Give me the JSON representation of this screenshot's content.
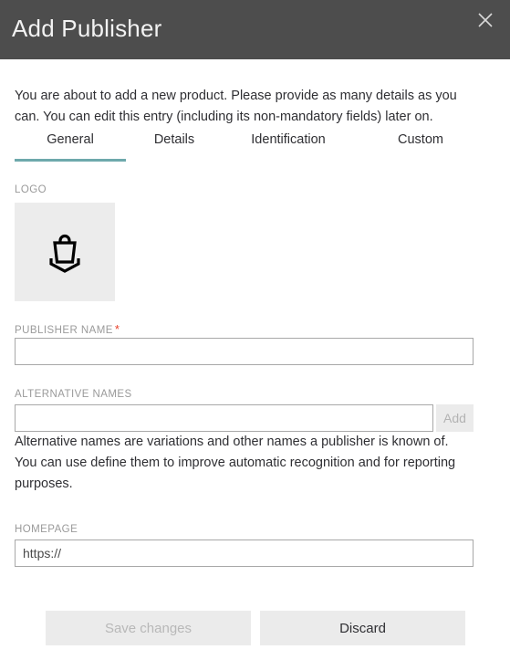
{
  "header": {
    "title": "Add Publisher",
    "close_icon": "close-icon"
  },
  "intro": {
    "text": "You are about to add a new product. Please provide as many details as you can. You can edit this entry (including its non-mandatory fields) later on."
  },
  "tabs": [
    {
      "label": "General",
      "active": true
    },
    {
      "label": "Details",
      "active": false
    },
    {
      "label": "Identification",
      "active": false
    },
    {
      "label": "Custom",
      "active": false
    }
  ],
  "fields": {
    "logo": {
      "label": "LOGO",
      "icon": "shopping-bag-upload-icon"
    },
    "publisher_name": {
      "label": "PUBLISHER NAME",
      "required_marker": "*",
      "value": "",
      "placeholder": ""
    },
    "alternative_names": {
      "label": "ALTERNATIVE NAMES",
      "value": "",
      "placeholder": "",
      "add_label": "Add",
      "help": "Alternative names are variations and other names a publisher is known of. You can use define them to improve automatic recognition and for reporting purposes."
    },
    "homepage": {
      "label": "HOMEPAGE",
      "value": "https://",
      "placeholder": "https://"
    }
  },
  "footer": {
    "save_label": "Save changes",
    "discard_label": "Discard"
  },
  "colors": {
    "header_bg": "#4d4d4d",
    "accent_underline": "#6ea9ac",
    "required_star": "#e8412a",
    "button_bg": "#ebebeb",
    "logo_box_bg": "#ececec"
  }
}
